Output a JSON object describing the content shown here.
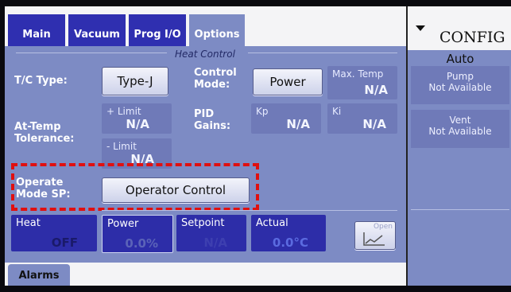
{
  "tabs": [
    {
      "label": "Main"
    },
    {
      "label": "Vacuum"
    },
    {
      "label": "Prog I/O"
    },
    {
      "label": "Options"
    }
  ],
  "section_heat_control": "Heat Control",
  "tc_type": {
    "label": "T/C Type:",
    "button": "Type-J"
  },
  "control_mode": {
    "label": "Control Mode:",
    "button": "Power"
  },
  "max_temp": {
    "label": "Max. Temp",
    "value": "N/A"
  },
  "at_temp": {
    "label": "At-Temp Tolerance:",
    "plus_limit": {
      "label": "+ Limit",
      "value": "N/A"
    },
    "minus_limit": {
      "label": "- Limit",
      "value": "N/A"
    }
  },
  "pid": {
    "label": "PID Gains:",
    "kp": {
      "label": "Kp",
      "value": "N/A"
    },
    "ki": {
      "label": "Ki",
      "value": "N/A"
    }
  },
  "operate_mode": {
    "label": "Operate Mode SP:",
    "button": "Operator Control"
  },
  "status": {
    "heat": {
      "label": "Heat",
      "value": "OFF"
    },
    "power": {
      "label": "Power",
      "value": "0.0%"
    },
    "setpoint": {
      "label": "Setpoint",
      "value": "N/A"
    },
    "actual": {
      "label": "Actual",
      "value": "0.0°C"
    },
    "open_label": "Open"
  },
  "bottom_tab": "Alarms",
  "right_panel": {
    "title": "CONFIG",
    "mode": "Auto",
    "pump": {
      "label": "Pump",
      "value": "Not Available"
    },
    "vent": {
      "label": "Vent",
      "value": "Not Available"
    }
  },
  "colors": {
    "panel": "#7d8bc4",
    "tab": "#2f2fb0",
    "highlight": "#e01010"
  }
}
